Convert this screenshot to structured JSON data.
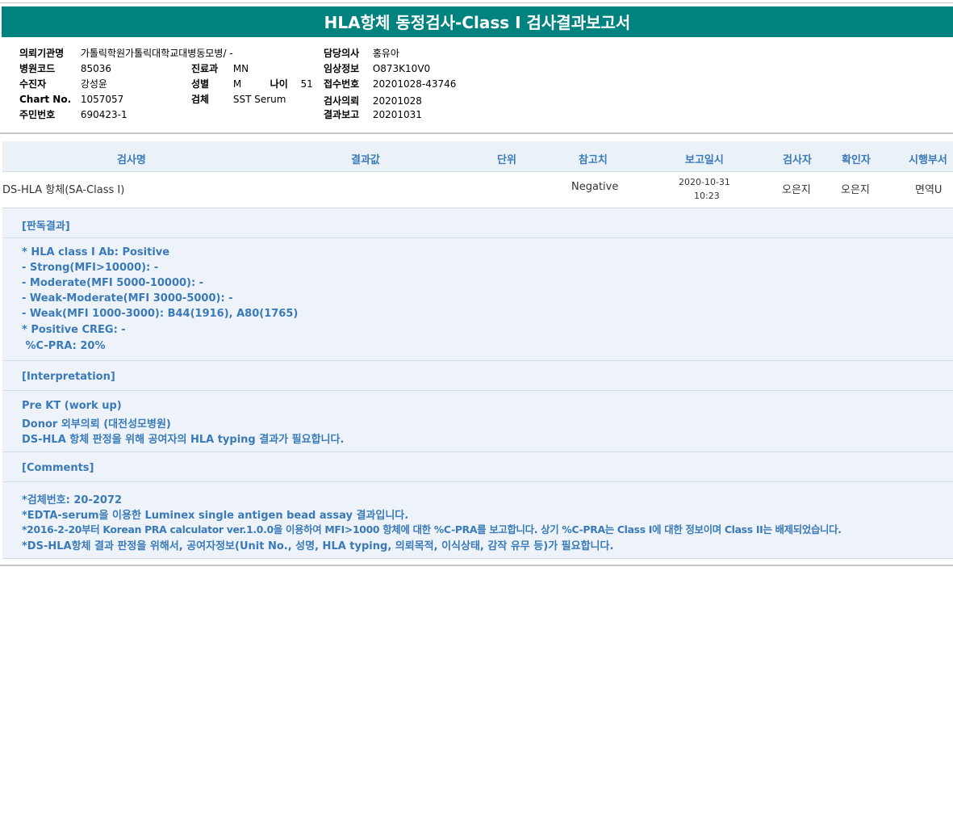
{
  "title": "HLA항체 동정검사-Class I 검사결과보고서",
  "patient": {
    "institution_label": "의뢰기관명",
    "institution": "가톨릭학원가톨릭대학교대병동모병/ -",
    "hospital_code_label": "병원코드",
    "hospital_code": "85036",
    "name_label": "수진자",
    "name": "강성윤",
    "chart_label": "Chart No.",
    "chart_no": "1057057",
    "resident_label": "주민번호",
    "resident_no": "690423-1",
    "dept_label": "진료과",
    "dept": "MN",
    "sex_label": "성별",
    "sex": "M",
    "age_label": "나이",
    "age": "51",
    "specimen_label": "검체",
    "specimen": "SST Serum",
    "doctor_label": "담당의사",
    "doctor": "홍유아",
    "clinical_label": "임상정보",
    "clinical": "O873K10V0",
    "receipt_label": "접수번호",
    "receipt": "20201028-43746",
    "request_label": "검사의뢰",
    "request": "20201028",
    "report_label": "결과보고",
    "report": "20201031"
  },
  "table": {
    "headers": [
      "검사명",
      "결과값",
      "단위",
      "참고치",
      "보고일시",
      "검사자",
      "확인자",
      "시행부서"
    ],
    "row": {
      "name": "DS-HLA 항체(SA-Class I)",
      "reference": "Negative",
      "report_date": "2020-10-31",
      "report_time": "10:23",
      "tester": "오은지",
      "confirmer": "오은지",
      "dept": "면역U"
    }
  },
  "sections": {
    "judgement_title": "[판독결과]",
    "judgement_lines": [
      "* HLA class I Ab: Positive",
      "- Strong(MFI>10000): -",
      "- Moderate(MFI 5000-10000): -",
      "- Weak-Moderate(MFI 3000-5000): -",
      "- Weak(MFI 1000-3000): B44(1916), A80(1765)",
      "* Positive CREG: -",
      " %C-PRA: 20%"
    ],
    "interp_title": "[Interpretation]",
    "interp_lines": [
      "Pre KT (work up)",
      "Donor 외부의뢰 (대전성모병원)",
      "DS-HLA 항체 판정을 위해 공여자의 HLA typing 결과가 필요합니다."
    ],
    "comments_title": "[Comments]",
    "comments_lines": [
      "*검체번호: 20-2072",
      "*EDTA-serum을 이용한 Luminex single antigen bead assay 결과입니다.",
      "*2016-2-20부터 Korean PRA calculator ver.1.0.0을 이용하여 MFI>1000 항체에 대한 %C-PRA를 보고합니다. 상기 %C-PRA는 Class I에 대한 정보이며 Class II는 배제되었습니다.",
      "*DS-HLA항체 결과 판정을 위해서, 공여자정보(Unit No., 성명, HLA typing, 의뢰목적, 이식상태, 감작 유무 등)가 필요합니다."
    ]
  }
}
